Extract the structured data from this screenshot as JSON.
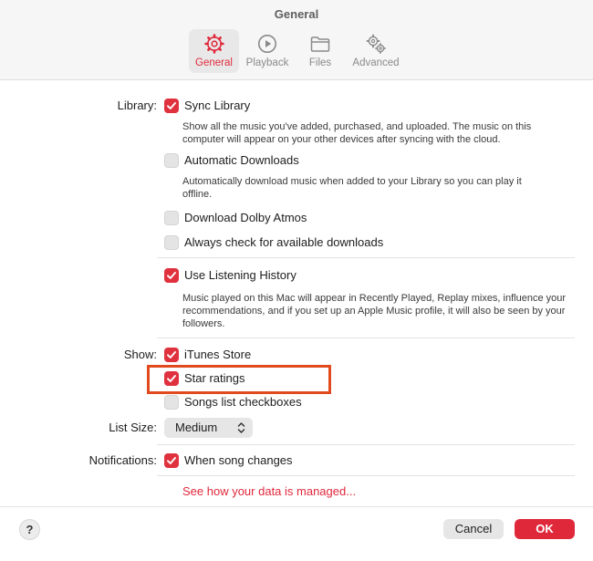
{
  "window": {
    "title": "General"
  },
  "tabs": [
    {
      "label": "General",
      "icon": "gear-icon",
      "active": true
    },
    {
      "label": "Playback",
      "icon": "play-circle-icon",
      "active": false
    },
    {
      "label": "Files",
      "icon": "folder-icon",
      "active": false
    },
    {
      "label": "Advanced",
      "icon": "gears-icon",
      "active": false
    }
  ],
  "library": {
    "label": "Library:",
    "sync": {
      "label": "Sync Library",
      "checked": true,
      "description": "Show all the music you've added, purchased, and uploaded. The music on this computer will appear on your other devices after syncing with the cloud."
    },
    "auto_downloads": {
      "label": "Automatic Downloads",
      "checked": false,
      "description": "Automatically download music when added to your Library so you can play it offline."
    },
    "dolby": {
      "label": "Download Dolby Atmos",
      "checked": false
    },
    "always_check": {
      "label": "Always check for available downloads",
      "checked": false
    }
  },
  "history": {
    "label": "Use Listening History",
    "checked": true,
    "description": "Music played on this Mac will appear in Recently Played, Replay mixes, influence your recommendations, and if you set up an Apple Music profile, it will also be seen by your followers."
  },
  "show": {
    "label": "Show:",
    "itunes_store": {
      "label": "iTunes Store",
      "checked": true
    },
    "star_ratings": {
      "label": "Star ratings",
      "checked": true
    },
    "songs_list_checkboxes": {
      "label": "Songs list checkboxes",
      "checked": false
    }
  },
  "list_size": {
    "label": "List Size:",
    "value": "Medium"
  },
  "notifications": {
    "label": "Notifications:",
    "when_song_changes": {
      "label": "When song changes",
      "checked": true
    }
  },
  "data_link": "See how your data is managed...",
  "footer": {
    "help": "?",
    "cancel": "Cancel",
    "ok": "OK"
  },
  "colors": {
    "accent": "#e0283b",
    "highlight_box": "#e14a1e"
  }
}
